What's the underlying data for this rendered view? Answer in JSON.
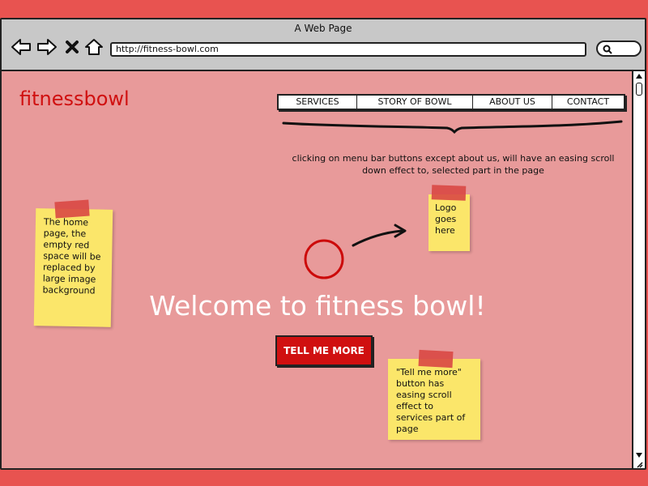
{
  "window": {
    "title": "A Web Page"
  },
  "toolbar": {
    "back_icon": "back-arrow-icon",
    "forward_icon": "forward-arrow-icon",
    "stop_icon": "close-icon",
    "home_icon": "home-icon",
    "url": "http://fitness-bowl.com",
    "search_icon": "search-icon"
  },
  "site": {
    "logo": "fitnessbowl",
    "menu": [
      "SERVICES",
      "STORY OF BOWL",
      "ABOUT US",
      "CONTACT"
    ],
    "menu_note": "clicking on menu bar buttons except about us, will have an easing scroll down effect to, selected part in the page",
    "headline": "Welcome to fitness bowl!",
    "cta_label": "TELL ME MORE"
  },
  "notes": {
    "home_bg": "The home page, the empty red space will be replaced by large image background",
    "logo": "Logo goes here",
    "cta": "\"Tell me more\" button has easing scroll effect to services part of page"
  },
  "colors": {
    "accent": "#d01010",
    "page_bg": "#e89a9a",
    "frame_bg": "#e85350",
    "sticky": "#fbe66a"
  }
}
